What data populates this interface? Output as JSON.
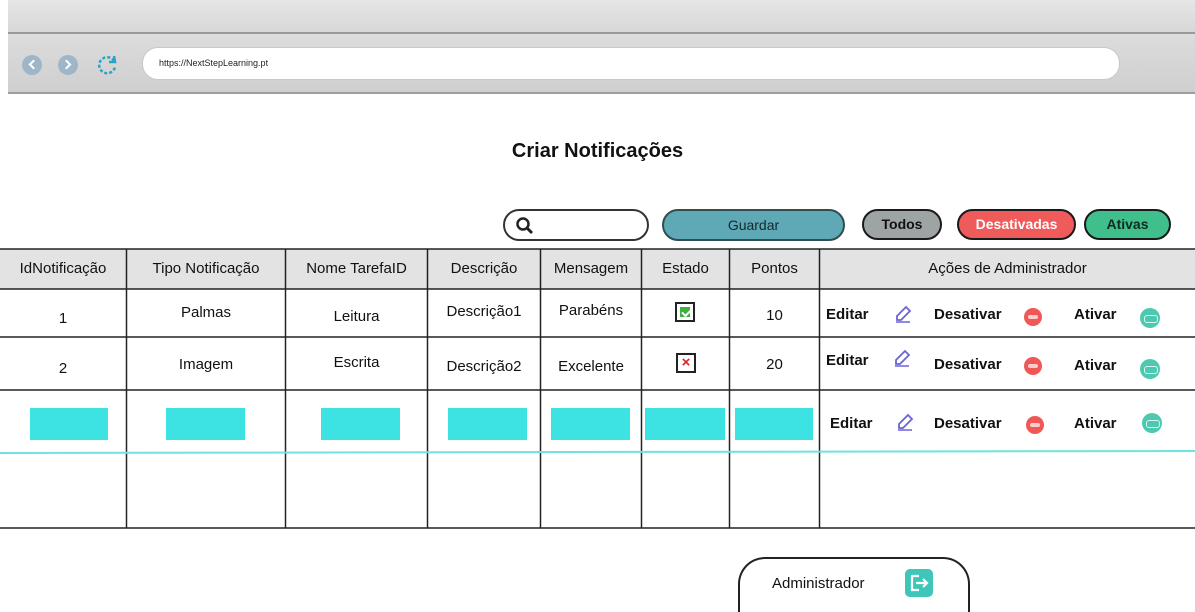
{
  "browser": {
    "url": "https://NextStepLearning.pt"
  },
  "page": {
    "title": "Criar Notificações"
  },
  "toolbar": {
    "search_value": "",
    "save_label": "Guardar",
    "filters": [
      "Todos",
      "Desativadas",
      "Ativas"
    ]
  },
  "table": {
    "headers": [
      "IdNotificação",
      "Tipo Notificação",
      "Nome TarefaID",
      "Descrição",
      "Mensagem",
      "Estado",
      "Pontos",
      "Ações de Administrador"
    ],
    "rows": [
      {
        "id": "1",
        "tipo": "Palmas",
        "nome": "Leitura",
        "descricao": "Descrição1",
        "mensagem": "Parabéns",
        "estado": "checked",
        "pontos": "10"
      },
      {
        "id": "2",
        "tipo": "Imagem",
        "nome": "Escrita",
        "descricao": "Descrição2",
        "mensagem": "Excelente",
        "estado": "unchecked",
        "pontos": "20"
      }
    ],
    "actions": {
      "edit": "Editar",
      "deactivate": "Desativar",
      "activate": "Ativar"
    }
  },
  "footer": {
    "admin_label": "Administrador"
  },
  "colors": {
    "accent_teal": "#5fa8b5",
    "new_row_cyan": "#3de3e3",
    "red": "#ef5a5a",
    "green": "#3fbf8c"
  }
}
